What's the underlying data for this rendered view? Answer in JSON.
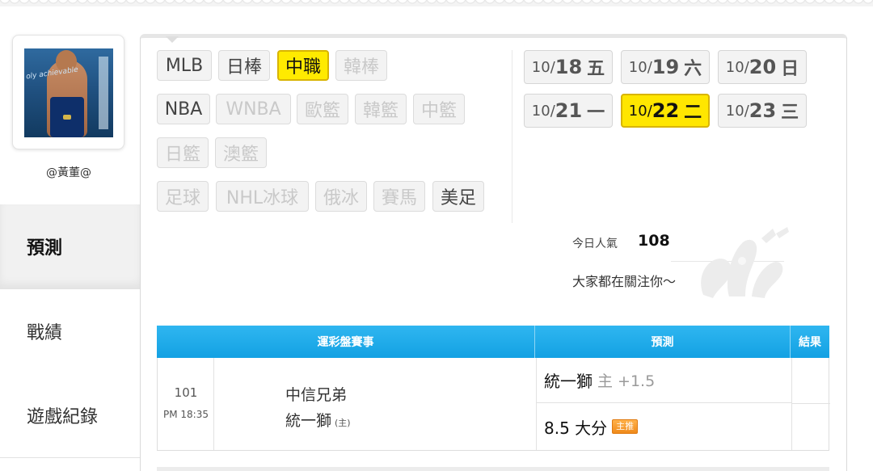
{
  "user": {
    "name": "@黃董@",
    "avatar_caption": "oly achievable"
  },
  "nav": [
    {
      "label": "預測",
      "active": true
    },
    {
      "label": "戰績",
      "active": false
    },
    {
      "label": "遊戲紀錄",
      "active": false
    }
  ],
  "leagues": {
    "row1": [
      {
        "label": "MLB",
        "state": "normal"
      },
      {
        "label": "日棒",
        "state": "normal"
      },
      {
        "label": "中職",
        "state": "active"
      },
      {
        "label": "韓棒",
        "state": "disabled"
      }
    ],
    "row2": [
      {
        "label": "NBA",
        "state": "normal"
      },
      {
        "label": "WNBA",
        "state": "disabled"
      },
      {
        "label": "歐籃",
        "state": "disabled"
      },
      {
        "label": "韓籃",
        "state": "disabled"
      },
      {
        "label": "中籃",
        "state": "disabled"
      }
    ],
    "row3": [
      {
        "label": "日籃",
        "state": "disabled"
      },
      {
        "label": "澳籃",
        "state": "disabled"
      }
    ],
    "row4": [
      {
        "label": "足球",
        "state": "disabled"
      },
      {
        "label": "NHL冰球",
        "state": "disabled"
      },
      {
        "label": "俄冰",
        "state": "disabled"
      },
      {
        "label": "賽馬",
        "state": "disabled"
      },
      {
        "label": "美足",
        "state": "normal"
      }
    ]
  },
  "dates": [
    {
      "month": "10/",
      "day": "18",
      "weekday": "五",
      "active": false
    },
    {
      "month": "10/",
      "day": "19",
      "weekday": "六",
      "active": false
    },
    {
      "month": "10/",
      "day": "20",
      "weekday": "日",
      "active": false
    },
    {
      "month": "10/",
      "day": "21",
      "weekday": "一",
      "active": false
    },
    {
      "month": "10/",
      "day": "22",
      "weekday": "二",
      "active": true
    },
    {
      "month": "10/",
      "day": "23",
      "weekday": "三",
      "active": false
    }
  ],
  "popularity": {
    "label": "今日人氣",
    "value": "108",
    "message": "大家都在關注你～"
  },
  "table": {
    "headers": {
      "event": "運彩盤賽事",
      "prediction": "預測",
      "result": "結果"
    },
    "rows": [
      {
        "number": "101",
        "time": "PM 18:35",
        "away_team": "中信兄弟",
        "home_team": "統一獅",
        "home_tag": "(主)",
        "pred_spread_team": "統一獅",
        "pred_spread_side": "主 +1.5",
        "pred_total": "8.5 大分",
        "pred_total_badge": "主推",
        "result": ""
      }
    ]
  },
  "colors": {
    "accent_yellow": "#ffea00",
    "header_blue": "#13a1e3",
    "badge_orange": "#f08a1a"
  }
}
